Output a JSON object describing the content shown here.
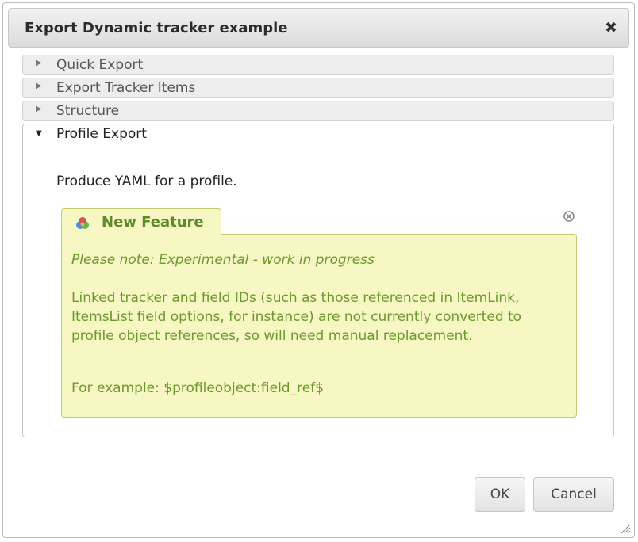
{
  "dialog": {
    "title": "Export Dynamic tracker example",
    "close_icon": "close-icon",
    "close_glyph": "✖"
  },
  "accordion": {
    "sections": [
      {
        "label": "Quick Export",
        "expanded": false
      },
      {
        "label": "Export Tracker Items",
        "expanded": false
      },
      {
        "label": "Structure",
        "expanded": false
      },
      {
        "label": "Profile Export",
        "expanded": true
      }
    ],
    "collapsed_icon": "caret-right-icon",
    "expanded_icon": "caret-down-icon"
  },
  "profile_export": {
    "intro": "Produce YAML for a profile."
  },
  "feature": {
    "icon": "feature-cube-icon",
    "title": "New Feature",
    "note": "Please note: Experimental - work in progress",
    "description": "Linked tracker and field IDs (such as those referenced in ItemLink, ItemsList field options, for instance) are not currently converted to profile object references, so will need manual replacement.",
    "example": "For example: $profileobject:field_ref$",
    "close_icon": "circle-close-icon"
  },
  "buttons": {
    "ok": "OK",
    "cancel": "Cancel"
  },
  "colors": {
    "feature_bg": "#f7f7c4",
    "feature_border": "#c5c970",
    "feature_text": "#6a9a2c",
    "feature_title": "#5f8a2a"
  }
}
